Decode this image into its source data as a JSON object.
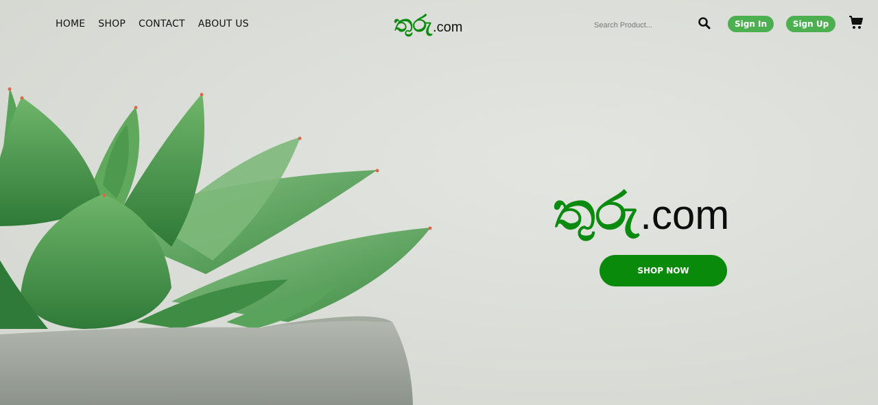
{
  "nav": {
    "items": [
      {
        "label": "HOME"
      },
      {
        "label": "SHOP"
      },
      {
        "label": "CONTACT"
      },
      {
        "label": "ABOUT US"
      }
    ]
  },
  "logo": {
    "sinhala": "තුරු",
    "suffix": ".com"
  },
  "search": {
    "placeholder": "Search Product...",
    "icon": "search-icon"
  },
  "auth": {
    "sign_in": "Sign In",
    "sign_up": "Sign Up"
  },
  "cart": {
    "icon": "shopping-cart-icon"
  },
  "hero": {
    "brand_sinhala": "තුරු",
    "brand_suffix": ".com",
    "cta": "SHOP NOW"
  },
  "colors": {
    "brand_green": "#0b8a10",
    "pill_green": "#4caf50",
    "background": "#d9dcd6"
  }
}
